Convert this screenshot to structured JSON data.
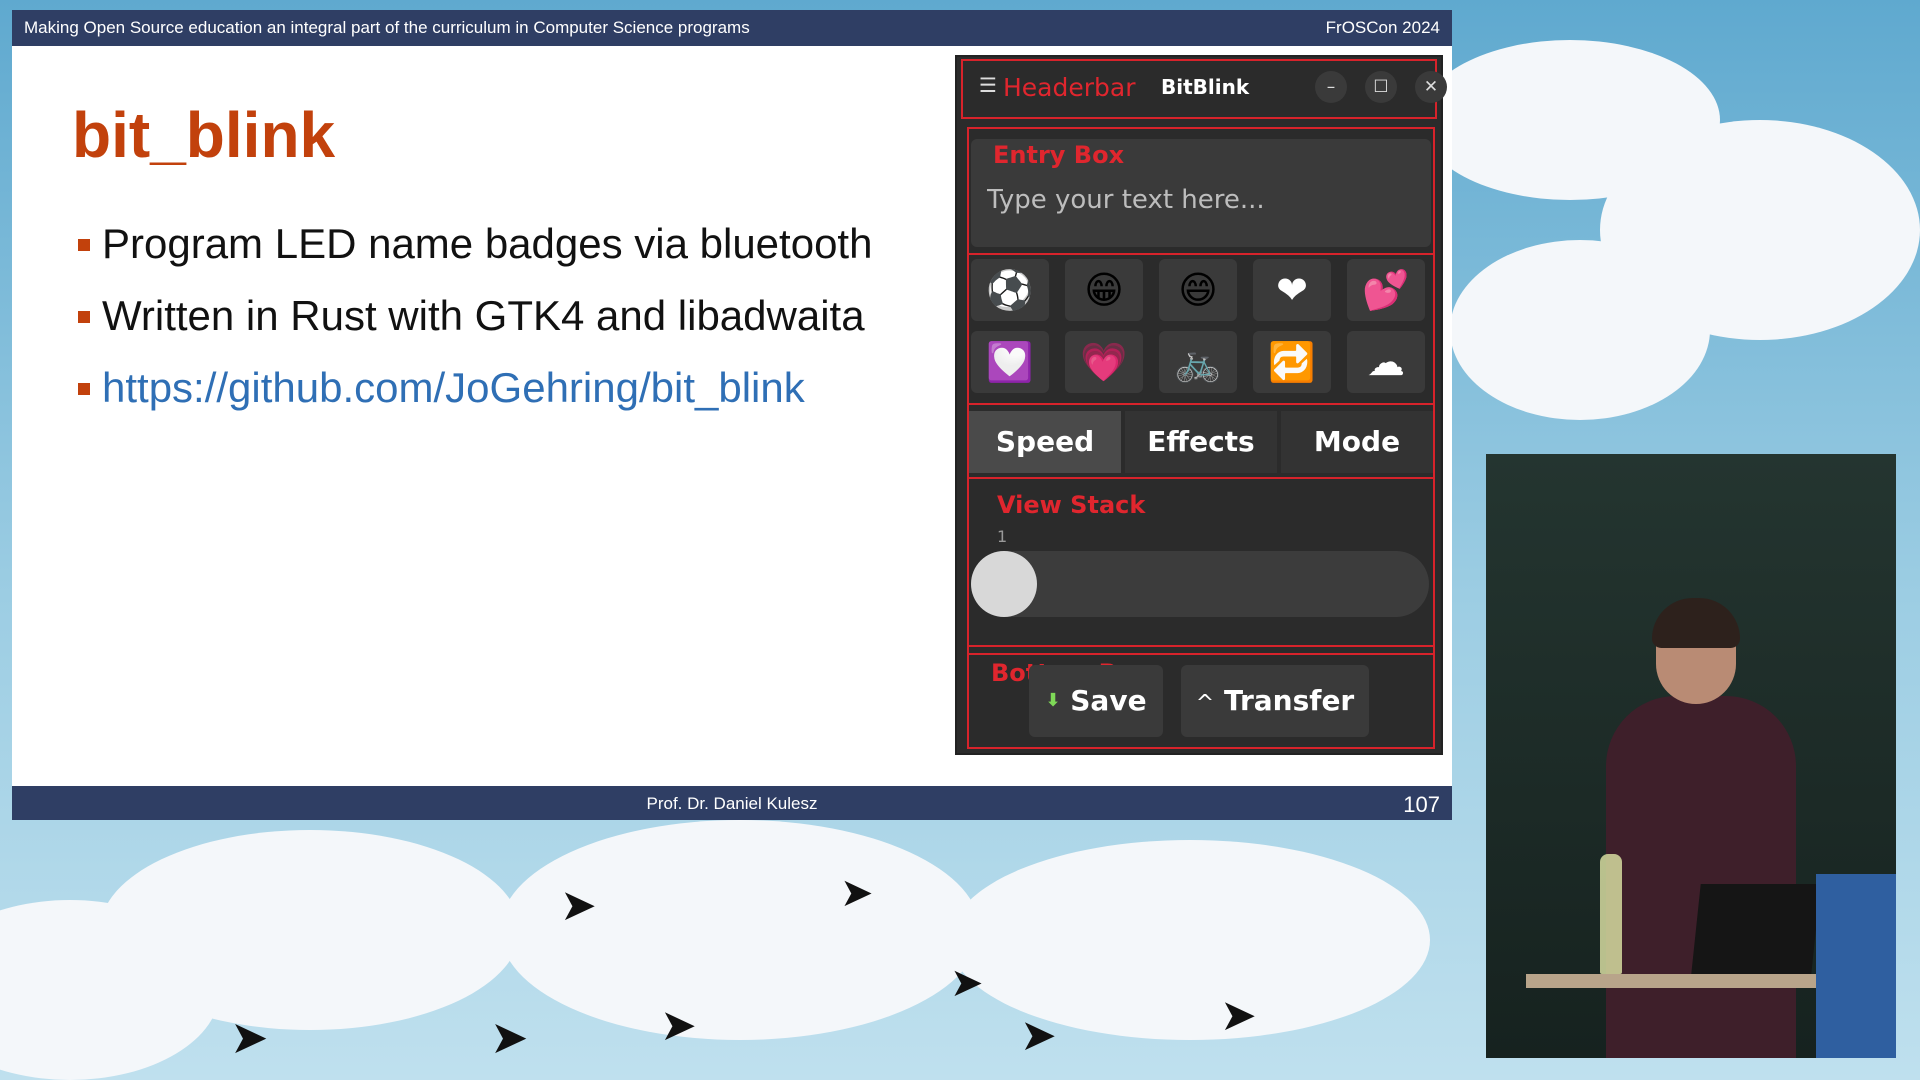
{
  "slide": {
    "topbar_left": "Making Open Source education an integral part of the curriculum in Computer Science programs",
    "topbar_right": "FrOSCon 2024",
    "title": "bit_blink",
    "bullets": [
      "Program LED name badges via bluetooth",
      "Written in Rust with GTK4 and libadwaita",
      "https://github.com/JoGehring/bit_blink"
    ],
    "footer_center": "Prof. Dr. Daniel Kulesz",
    "footer_page": "107"
  },
  "app": {
    "headerbar_label": "Headerbar",
    "title": "BitBlink",
    "menu_icon": "☰",
    "minimize": "–",
    "maximize": "☐",
    "close": "✕",
    "entry_box_label": "Entry Box",
    "entry_placeholder": "Type your text here...",
    "emojis": [
      "⚽",
      "😁",
      "😄",
      "❤",
      "💕",
      "💟",
      "💗",
      "🚲",
      "🔁",
      "☁"
    ],
    "tabs": [
      "Speed",
      "Effects",
      "Mode"
    ],
    "active_tab": "Speed",
    "view_stack_label": "View Stack",
    "slider_value": "1",
    "bottom_box_label": "Bottom Box",
    "save_icon": "⬇",
    "save_label": "Save",
    "transfer_icon": "^",
    "transfer_label": "Transfer"
  },
  "colors": {
    "slide_bar": "#2f3e64",
    "title_accent": "#c2410c",
    "link": "#2f6fb5",
    "debug_red": "#e0262e",
    "app_bg": "#2b2b2b"
  }
}
